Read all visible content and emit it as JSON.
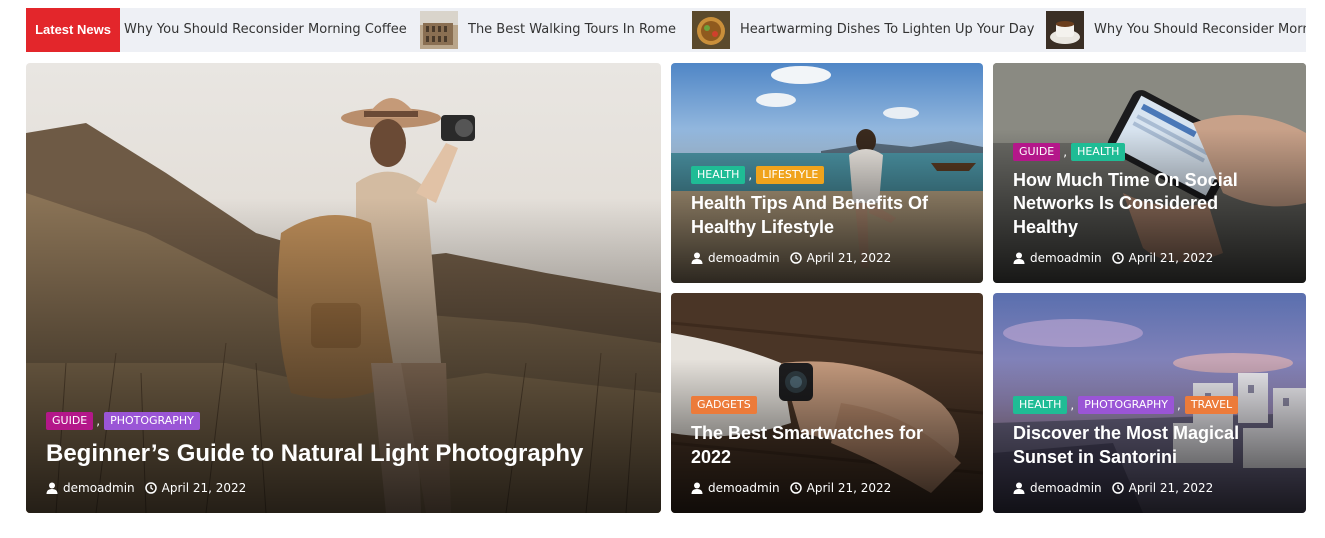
{
  "ticker": {
    "label": "Latest News",
    "items": [
      {
        "title": "Why You Should Reconsider Morning Coffee",
        "thumb": "none"
      },
      {
        "title": "The Best Walking Tours In Rome",
        "thumb": "colosseum"
      },
      {
        "title": "Heartwarming Dishes To Lighten Up Your Day",
        "thumb": "dish"
      },
      {
        "title": "Why You Should Reconsider Morning Coffee",
        "thumb": "coffee"
      }
    ]
  },
  "colors": {
    "ticker_label_bg": "#e3262b",
    "guide": "#b4178a",
    "photography": "#9a55d6",
    "health": "#1fbc95",
    "lifestyle": "#f0a31c",
    "gadgets": "#ec7b3a",
    "travel": "#ec7b3a"
  },
  "posts": [
    {
      "categories": [
        "GUIDE",
        "PHOTOGRAPHY"
      ],
      "title": "Beginner’s Guide to Natural Light Photography",
      "author": "demoadmin",
      "date": "April 21, 2022",
      "image": "woman-with-camera-and-backpack"
    },
    {
      "categories": [
        "HEALTH",
        "LIFESTYLE"
      ],
      "title": "Health Tips And Benefits Of Healthy Lifestyle",
      "author": "demoadmin",
      "date": "April 21, 2022",
      "image": "woman-yoga-on-beach"
    },
    {
      "categories": [
        "GUIDE",
        "HEALTH"
      ],
      "title": "How Much Time On Social Networks Is Considered Healthy",
      "author": "demoadmin",
      "date": "April 21, 2022",
      "image": "hand-holding-phone"
    },
    {
      "categories": [
        "GADGETS"
      ],
      "title": "The Best Smartwatches for 2022",
      "author": "demoadmin",
      "date": "April 21, 2022",
      "image": "wrist-smartwatch"
    },
    {
      "categories": [
        "HEALTH",
        "PHOTOGRAPHY",
        "TRAVEL"
      ],
      "title": "Discover the Most Magical Sunset in Santorini",
      "author": "demoadmin",
      "date": "April 21, 2022",
      "image": "santorini-sunset"
    }
  ]
}
